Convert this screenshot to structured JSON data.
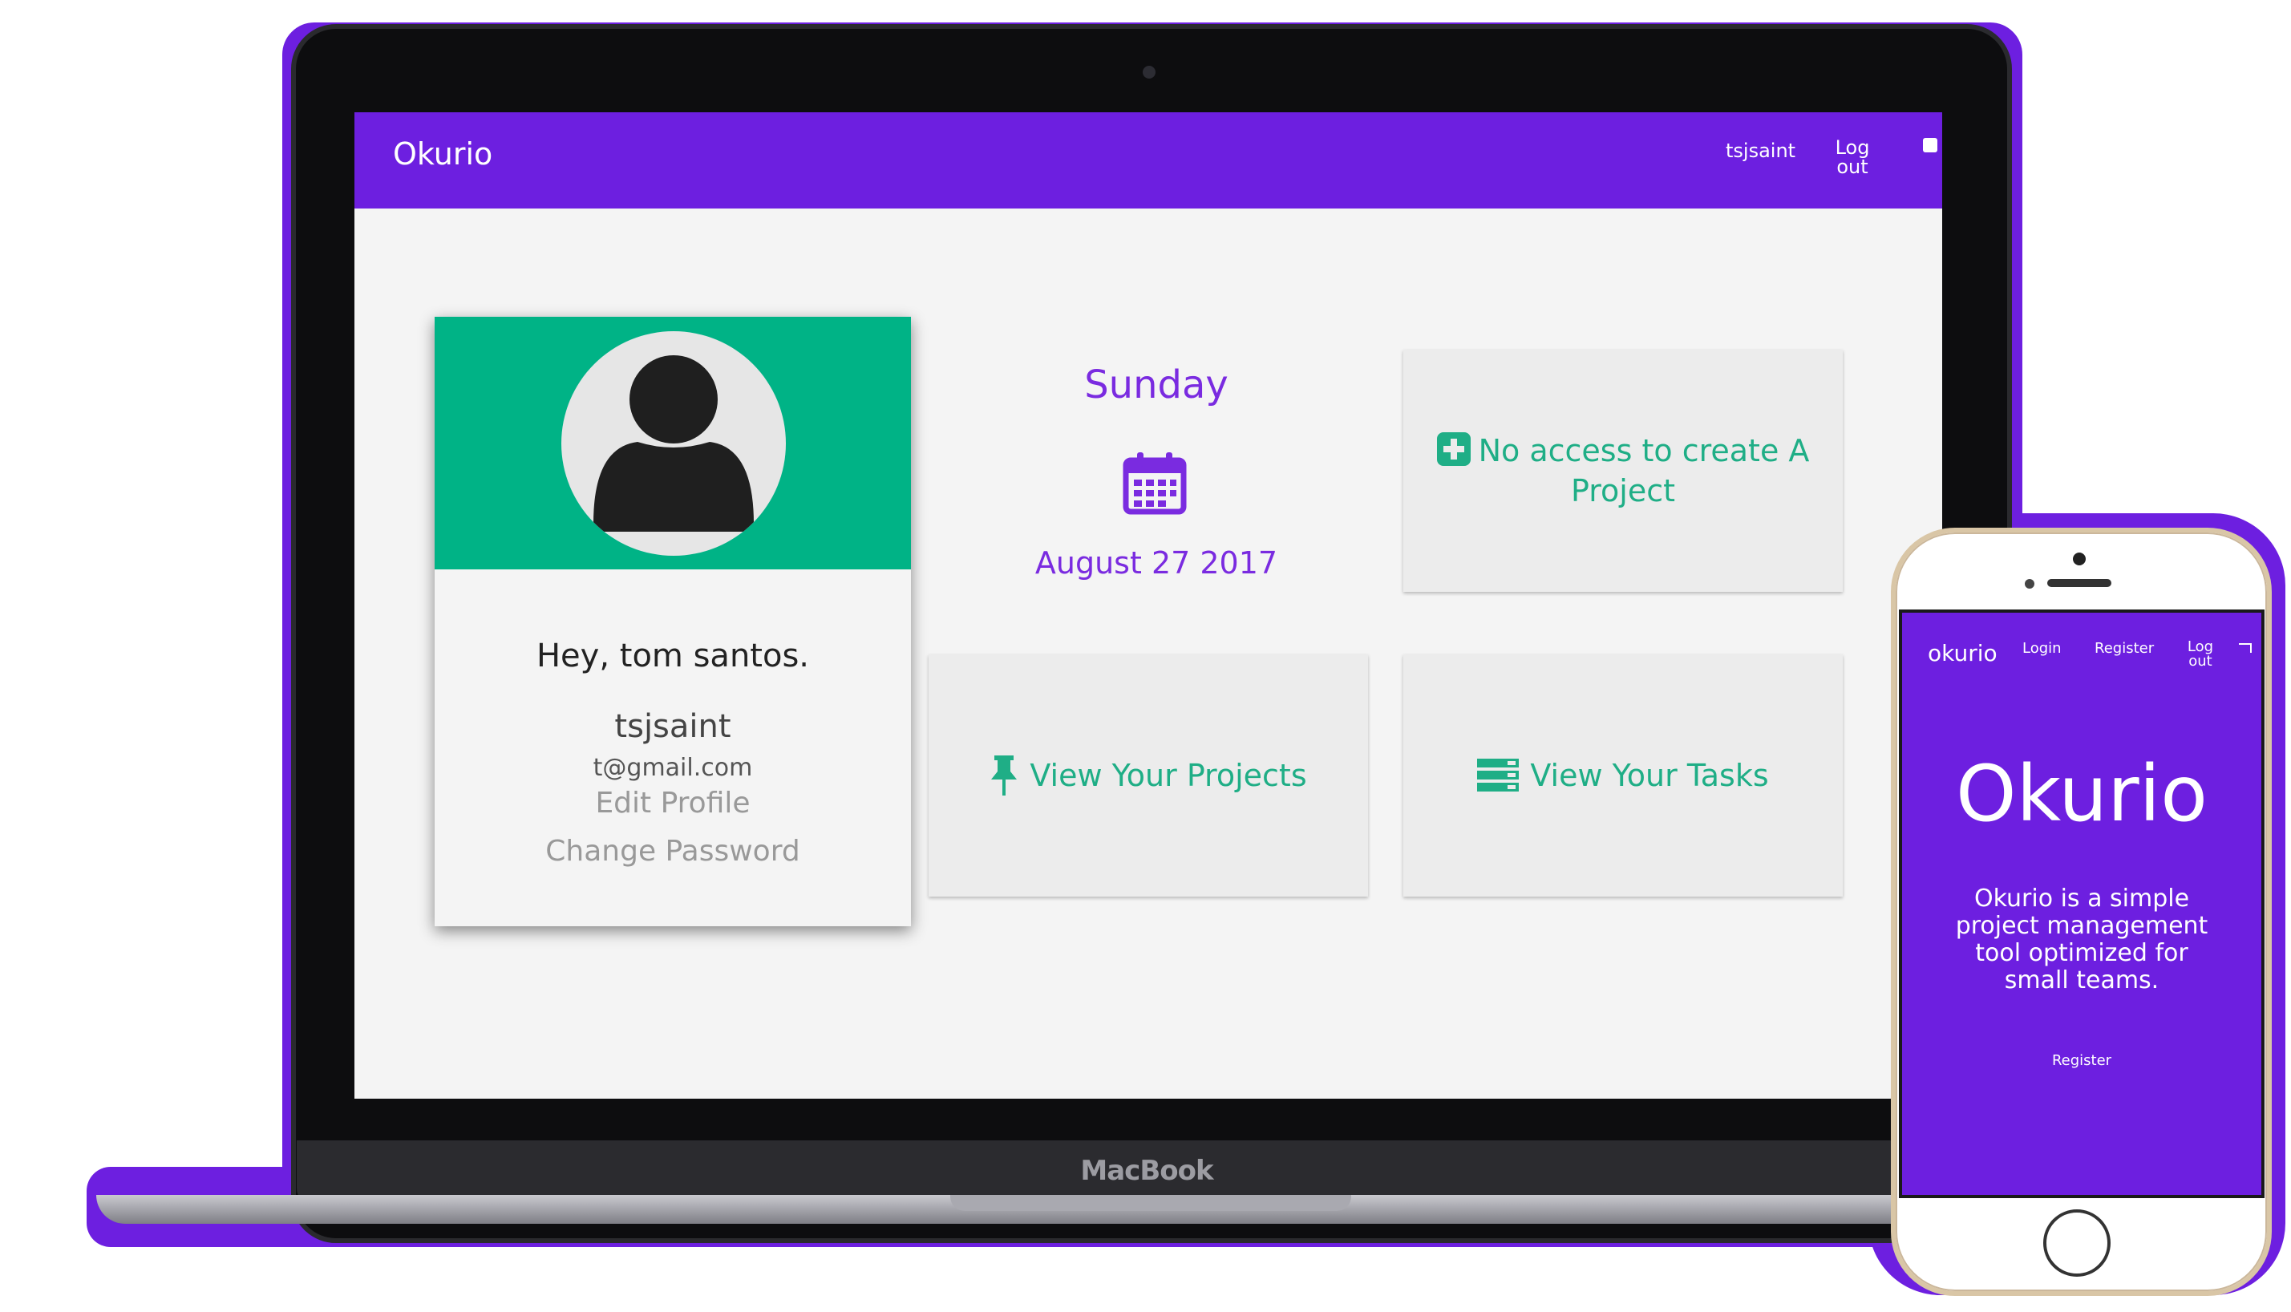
{
  "colors": {
    "accent": "#6d1fe0",
    "green": "#00b386",
    "screen_bg": "#f4f4f4"
  },
  "laptop": {
    "brand": "MacBook",
    "navbar": {
      "brand": "Okurio",
      "user": "tsjsaint",
      "logout": "Log out"
    },
    "profile": {
      "greeting": "Hey, tom santos.",
      "username": "tsjsaint",
      "email": "t@gmail.com",
      "edit_profile": "Edit Profile",
      "change_password": "Change Password",
      "avatar_icon": "user-silhouette-icon"
    },
    "date": {
      "day": "Sunday",
      "calendar_icon": "calendar-icon",
      "date": "August 27 2017"
    },
    "tiles": {
      "create_project": "No access to create A Project",
      "create_icon": "plus-square-icon",
      "view_projects": "View Your Projects",
      "projects_icon": "pin-icon",
      "view_tasks": "View Your Tasks",
      "tasks_icon": "tasks-list-icon"
    }
  },
  "phone": {
    "nav": {
      "brand": "okurio",
      "login": "Login",
      "register": "Register",
      "logout": "Log out"
    },
    "hero": {
      "title": "Okurio",
      "tagline": "Okurio is a simple project management tool optimized for small teams.",
      "register": "Register"
    }
  }
}
